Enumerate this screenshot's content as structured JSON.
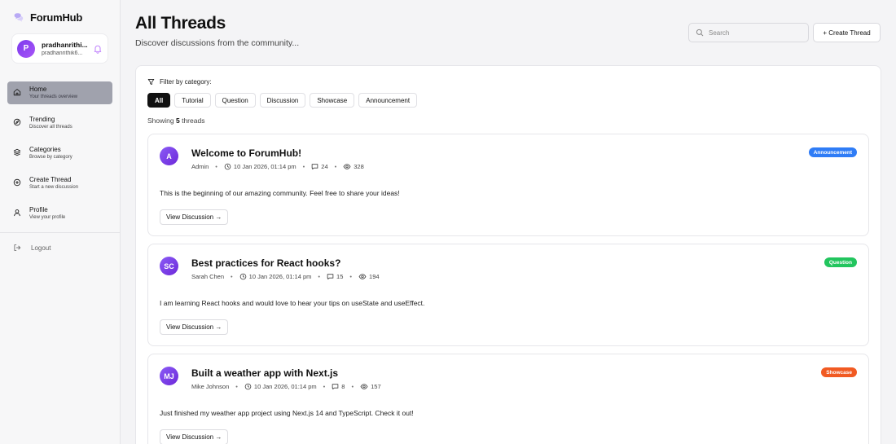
{
  "brand": {
    "name": "ForumHub"
  },
  "user": {
    "initial": "P",
    "name": "pradhanrithi...",
    "email": "pradhanrithik6..."
  },
  "nav": [
    {
      "label": "Home",
      "sub": "Your threads overview",
      "icon": "home-icon",
      "active": true
    },
    {
      "label": "Trending",
      "sub": "Discover all threads",
      "icon": "compass-icon",
      "active": false
    },
    {
      "label": "Categories",
      "sub": "Browse by category",
      "icon": "layers-icon",
      "active": false
    },
    {
      "label": "Create Thread",
      "sub": "Start a new discussion",
      "icon": "plus-circle-icon",
      "active": false
    },
    {
      "label": "Profile",
      "sub": "View your profile",
      "icon": "user-icon",
      "active": false
    }
  ],
  "logout_label": "Logout",
  "header": {
    "title": "All Threads",
    "subtitle": "Discover discussions from the community...",
    "search_placeholder": "Search",
    "create_label": "+ Create Thread"
  },
  "filter": {
    "title": "Filter by category:",
    "chips": [
      "All",
      "Tutorial",
      "Question",
      "Discussion",
      "Showcase",
      "Announcement"
    ],
    "active": "All"
  },
  "showing": {
    "prefix": "Showing",
    "count": "5",
    "suffix": "threads"
  },
  "threads": [
    {
      "initials": "A",
      "title": "Welcome to ForumHub!",
      "author": "Admin",
      "date": "10 Jan 2026, 01:14 pm",
      "comments": "24",
      "views": "328",
      "category": "Announcement",
      "category_color": "#2f7cf6",
      "body": "This is the beginning of our amazing community. Feel free to share your ideas!",
      "view_label": "View Discussion →"
    },
    {
      "initials": "SC",
      "title": "Best practices for React hooks?",
      "author": "Sarah Chen",
      "date": "10 Jan 2026, 01:14 pm",
      "comments": "15",
      "views": "194",
      "category": "Question",
      "category_color": "#22c55e",
      "body": "I am learning React hooks and would love to hear your tips on useState and useEffect.",
      "view_label": "View Discussion →"
    },
    {
      "initials": "MJ",
      "title": "Built a weather app with Next.js",
      "author": "Mike Johnson",
      "date": "10 Jan 2026, 01:14 pm",
      "comments": "8",
      "views": "157",
      "category": "Showcase",
      "category_color": "#f15a22",
      "body": "Just finished my weather app project using Next.js 14 and TypeScript. Check it out!",
      "view_label": "View Discussion →"
    }
  ],
  "colors": {
    "accent": "#7c3aed",
    "active_nav": "#a0a2ad",
    "background": "#f4f4f6"
  }
}
